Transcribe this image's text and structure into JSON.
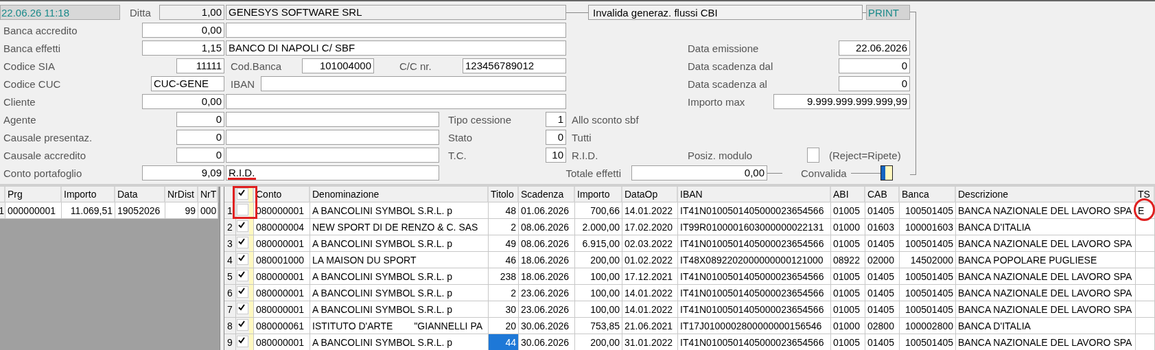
{
  "form": {
    "timestamp": "22.06.26 11:18",
    "ditta": {
      "label": "Ditta",
      "code": "1,00",
      "name": "GENESYS SOFTWARE SRL"
    },
    "cbi_button": "Invalida generaz. flussi CBI",
    "print_button": "PRINT",
    "banca_accredito": {
      "label": "Banca accredito",
      "value": "0,00"
    },
    "banca_effetti": {
      "label": "Banca effetti",
      "value": "1,15",
      "name": "BANCO DI NAPOLI C/ SBF"
    },
    "codice_sia": {
      "label": "Codice SIA",
      "value": "11111"
    },
    "cod_banca": {
      "label": "Cod.Banca",
      "value": "101004000"
    },
    "cc_nr": {
      "label": "C/C nr.",
      "value": "123456789012"
    },
    "codice_cuc": {
      "label": "Codice CUC",
      "value": "CUC-GENE"
    },
    "iban": {
      "label": "IBAN"
    },
    "cliente": {
      "label": "Cliente",
      "value": "0,00"
    },
    "agente": {
      "label": "Agente",
      "value": "0"
    },
    "causale_presentaz": {
      "label": "Causale presentaz.",
      "value": "0"
    },
    "causale_accredito": {
      "label": "Causale accredito",
      "value": "0"
    },
    "conto_portafoglio": {
      "label": "Conto portafoglio",
      "value": "9,09",
      "name": "R.I.D."
    },
    "data_emissione": {
      "label": "Data emissione",
      "value": "22.06.2026"
    },
    "data_scadenza_dal": {
      "label": "Data scadenza dal",
      "value": "0"
    },
    "data_scadenza_al": {
      "label": "Data scadenza al",
      "value": "0"
    },
    "importo_max": {
      "label": "Importo max",
      "value": "9.999.999.999.999,99"
    },
    "tipo_cessione": {
      "label": "Tipo cessione",
      "value": "1",
      "desc": "Allo sconto sbf"
    },
    "stato": {
      "label": "Stato",
      "value": "0",
      "desc": "Tutti"
    },
    "tc": {
      "label": "T.C.",
      "value": "10",
      "desc": "R.I.D."
    },
    "posiz_modulo": {
      "label": "Posiz. modulo",
      "checked": false,
      "note": "(Reject=Ripete)"
    },
    "totale_effetti": {
      "label": "Totale effetti",
      "value": "0,00"
    },
    "convalida": {
      "label": "Convalida"
    }
  },
  "distinte_table": {
    "columns": [
      "Prg",
      "Importo",
      "Data",
      "NrDist",
      "NrT"
    ],
    "rows": [
      {
        "n": "1",
        "cells": [
          "000000001",
          "11.069,51",
          "19052026",
          "99",
          "000"
        ]
      }
    ]
  },
  "effetti_table": {
    "header_checked": true,
    "columns": [
      "Conto",
      "Denominazione",
      "Titolo",
      "Scadenza",
      "Importo",
      "DataOp",
      "IBAN",
      "ABI",
      "CAB",
      "Banca",
      "Descrizione",
      "TS"
    ],
    "rows": [
      {
        "n": "1",
        "checked": false,
        "titolo_selected": false,
        "cells": [
          "080000001",
          "A BANCOLINI SYMBOL S.R.L. p",
          "48",
          "01.06.2026",
          "700,66",
          "14.01.2022",
          "IT41N0100501405000023654566",
          "01005",
          "01405",
          "100501405",
          "BANCA NAZIONALE DEL LAVORO SPA",
          "E"
        ]
      },
      {
        "n": "2",
        "checked": true,
        "titolo_selected": false,
        "cells": [
          "080000004",
          "NEW SPORT DI DE RENZO & C. SAS",
          "2",
          "08.06.2026",
          "2.000,00",
          "17.02.2020",
          "IT99R0100001603000000022131",
          "01000",
          "01603",
          "100001603",
          "BANCA D'ITALIA",
          ""
        ]
      },
      {
        "n": "3",
        "checked": true,
        "titolo_selected": false,
        "cells": [
          "080000001",
          "A BANCOLINI SYMBOL S.R.L. p",
          "49",
          "08.06.2026",
          "6.915,00",
          "02.03.2022",
          "IT41N0100501405000023654566",
          "01005",
          "01405",
          "100501405",
          "BANCA NAZIONALE DEL LAVORO SPA",
          ""
        ]
      },
      {
        "n": "4",
        "checked": true,
        "titolo_selected": false,
        "cells": [
          "080001000",
          "LA MAISON DU SPORT",
          "46",
          "18.06.2026",
          "200,00",
          "01.02.2022",
          "IT48X0892202000000000121000",
          "08922",
          "02000",
          "14502000",
          "BANCA POPOLARE PUGLIESE",
          ""
        ]
      },
      {
        "n": "5",
        "checked": true,
        "titolo_selected": false,
        "cells": [
          "080000001",
          "A BANCOLINI SYMBOL S.R.L. p",
          "238",
          "18.06.2026",
          "100,00",
          "17.12.2021",
          "IT41N0100501405000023654566",
          "01005",
          "01405",
          "100501405",
          "BANCA NAZIONALE DEL LAVORO SPA",
          ""
        ]
      },
      {
        "n": "6",
        "checked": true,
        "titolo_selected": false,
        "cells": [
          "080000001",
          "A BANCOLINI SYMBOL S.R.L. p",
          "2",
          "23.06.2026",
          "100,00",
          "14.01.2022",
          "IT41N0100501405000023654566",
          "01005",
          "01405",
          "100501405",
          "BANCA NAZIONALE DEL LAVORO SPA",
          ""
        ]
      },
      {
        "n": "7",
        "checked": true,
        "titolo_selected": false,
        "cells": [
          "080000001",
          "A BANCOLINI SYMBOL S.R.L. p",
          "30",
          "23.06.2026",
          "100,00",
          "14.01.2022",
          "IT41N0100501405000023654566",
          "01005",
          "01405",
          "100501405",
          "BANCA NAZIONALE DEL LAVORO SPA",
          ""
        ]
      },
      {
        "n": "8",
        "checked": true,
        "titolo_selected": false,
        "cells": [
          "080000061",
          "ISTITUTO D'ARTE        \"GIANNELLI PA",
          "20",
          "30.06.2026",
          "753,85",
          "21.06.2021",
          "IT17J0100002800000000156546",
          "01000",
          "02800",
          "100002800",
          "BANCA D'ITALIA",
          ""
        ]
      },
      {
        "n": "9",
        "checked": true,
        "titolo_selected": true,
        "cells": [
          "080000001",
          "A BANCOLINI SYMBOL S.R.L. p",
          "44",
          "30.06.2026",
          "200,00",
          "31.01.2022",
          "IT41N0100501405000023654566",
          "01005",
          "01405",
          "100501405",
          "BANCA NAZIONALE DEL LAVORO SPA",
          ""
        ]
      }
    ]
  },
  "annotations": [
    {
      "kind": "box"
    },
    {
      "kind": "ellipse"
    },
    {
      "kind": "underline"
    }
  ]
}
